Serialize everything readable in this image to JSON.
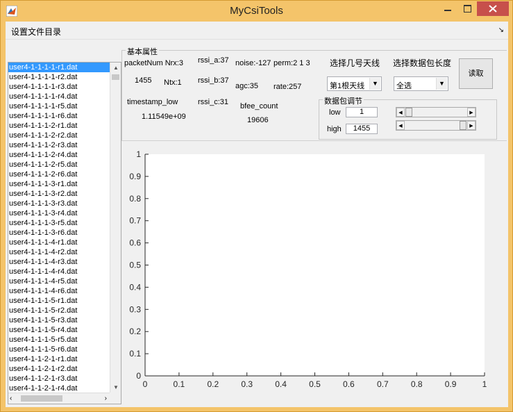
{
  "window": {
    "title": "MyCsiTools"
  },
  "menubar": {
    "set_dir_label": "设置文件目录",
    "dock_icon": "dock-arrow-icon"
  },
  "file_list": {
    "selected_index": 0,
    "items": [
      "user4-1-1-1-1-r1.dat",
      "user4-1-1-1-1-r2.dat",
      "user4-1-1-1-1-r3.dat",
      "user4-1-1-1-1-r4.dat",
      "user4-1-1-1-1-r5.dat",
      "user4-1-1-1-1-r6.dat",
      "user4-1-1-1-2-r1.dat",
      "user4-1-1-1-2-r2.dat",
      "user4-1-1-1-2-r3.dat",
      "user4-1-1-1-2-r4.dat",
      "user4-1-1-1-2-r5.dat",
      "user4-1-1-1-2-r6.dat",
      "user4-1-1-1-3-r1.dat",
      "user4-1-1-1-3-r2.dat",
      "user4-1-1-1-3-r3.dat",
      "user4-1-1-1-3-r4.dat",
      "user4-1-1-1-3-r5.dat",
      "user4-1-1-1-3-r6.dat",
      "user4-1-1-1-4-r1.dat",
      "user4-1-1-1-4-r2.dat",
      "user4-1-1-1-4-r3.dat",
      "user4-1-1-1-4-r4.dat",
      "user4-1-1-1-4-r5.dat",
      "user4-1-1-1-4-r6.dat",
      "user4-1-1-1-5-r1.dat",
      "user4-1-1-1-5-r2.dat",
      "user4-1-1-1-5-r3.dat",
      "user4-1-1-1-5-r4.dat",
      "user4-1-1-1-5-r5.dat",
      "user4-1-1-1-5-r6.dat",
      "user4-1-1-2-1-r1.dat",
      "user4-1-1-2-1-r2.dat",
      "user4-1-1-2-1-r3.dat",
      "user4-1-1-2-1-r4.dat"
    ]
  },
  "basic_props": {
    "title": "基本属性",
    "packetnum_nrx": "packetNum Nrx:3",
    "packetnum_value": "1455",
    "ntx": "Ntx:1",
    "rssi_a": "rssi_a:37",
    "rssi_b": "rssi_b:37",
    "rssi_c": "rssi_c:31",
    "noise": "noise:-127",
    "perm": "perm:2  1  3",
    "agc": "agc:35",
    "rate": "rate:257",
    "timestamp_label": "timestamp_low",
    "timestamp_value": "1.11549e+09",
    "bfee_label": "bfee_count",
    "bfee_value": "19606"
  },
  "antenna": {
    "label": "选择几号天线",
    "selected": "第1根天线"
  },
  "packet_length": {
    "label": "选择数据包长度",
    "selected": "全选"
  },
  "read_button": "读取",
  "packet_adjust": {
    "title": "数据包调节",
    "low_label": "low",
    "low_value": "1",
    "high_label": "high",
    "high_value": "1455",
    "low_slider_fraction": 0.0,
    "high_slider_fraction": 1.0
  },
  "chart_data": {
    "type": "line",
    "series": [],
    "xlim": [
      0,
      1
    ],
    "ylim": [
      0,
      1
    ],
    "x_ticks": [
      "0",
      "0.1",
      "0.2",
      "0.3",
      "0.4",
      "0.5",
      "0.6",
      "0.7",
      "0.8",
      "0.9",
      "1"
    ],
    "y_ticks": [
      "0",
      "0.1",
      "0.2",
      "0.3",
      "0.4",
      "0.5",
      "0.6",
      "0.7",
      "0.8",
      "0.9",
      "1"
    ],
    "grid": false
  },
  "colors": {
    "titlebar": "#f4c46a",
    "close_button": "#c7504b",
    "selection": "#3399ff"
  }
}
